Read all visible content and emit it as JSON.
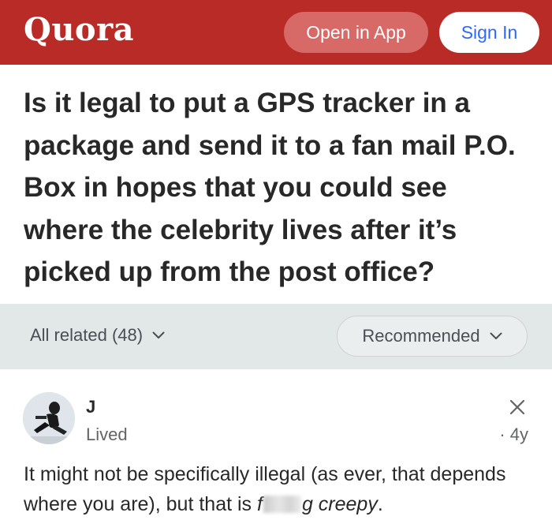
{
  "header": {
    "logo": "Quora",
    "open_in_app_label": "Open in App",
    "sign_in_label": "Sign In",
    "brand_color": "#b92b27"
  },
  "question": {
    "title": "Is it legal to put a GPS tracker in a package and send it to a fan mail P.O. Box in hopes that you could see where the celebrity lives after it’s picked up from the post office?"
  },
  "filters": {
    "related_label": "All related (48)",
    "sort_label": "Recommended"
  },
  "answer": {
    "author_name": "J",
    "author_credential": "Lived",
    "age": "· 4y",
    "text_plain": "It might not be specifically illegal (as ever, that depends where you are), but that is ",
    "text_italic_start": "f",
    "text_italic_end": "g creepy",
    "text_end": "."
  },
  "icons": {
    "dismiss": "close-icon",
    "dropdown": "chevron-down-icon",
    "avatar": "user-avatar"
  }
}
